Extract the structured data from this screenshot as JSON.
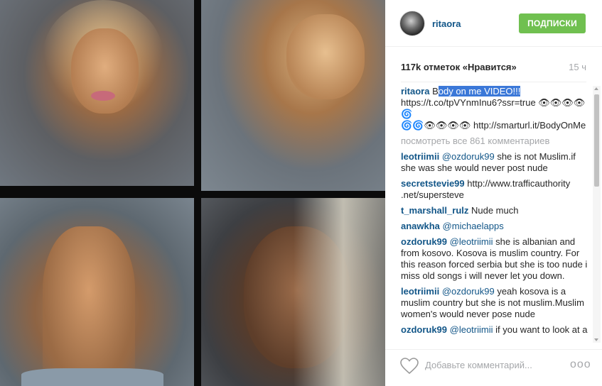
{
  "header": {
    "username": "ritaora",
    "follow_label": "ПОДПИСКИ"
  },
  "stats": {
    "likes": "117k отметок «Нравится»",
    "time": "15 ч"
  },
  "caption": {
    "user": "ritaora",
    "prefix": "B",
    "highlighted": "ody on me VIDEO!!!",
    "line2": "https://t.co/tpVYnmInu6?ssr=true 👁👁👁👁🌀",
    "line3": "🌀🌀👁👁👁👁 http://smarturl.it/BodyOnMe"
  },
  "view_all": "посмотреть все 861 комментариев",
  "comments": [
    {
      "user": "leotriimii",
      "mention": "@ozdoruk99",
      "text": " she is not Muslim.if she was she would never post nude"
    },
    {
      "user": "secretstevie99",
      "mention": "",
      "text": " http://www.trafficauthority .net/supersteve"
    },
    {
      "user": "t_marshall_rulz",
      "mention": "",
      "text": " Nude much"
    },
    {
      "user": "anawkha",
      "mention": "@michaelapps",
      "text": ""
    },
    {
      "user": "ozdoruk99",
      "mention": "@leotriimii",
      "text": " she is albanian and from kosovo. Kosova is muslim country. For this reason forced serbia but she is too nude i miss old songs i will never let you down."
    },
    {
      "user": "leotriimii",
      "mention": "@ozdoruk99",
      "text": " yeah kosova is a muslim country but she is not muslim.Muslim women's would never pose nude"
    },
    {
      "user": "ozdoruk99",
      "mention": "@leotriimii",
      "text": " if you want to look at a"
    }
  ],
  "footer": {
    "comment_placeholder": "Добавьте комментарий...",
    "more_dots": "ooo"
  },
  "icons": {
    "heart": "heart-icon",
    "more": "more-options-icon"
  },
  "colors": {
    "username": "#125688",
    "follow_button": "#70c050",
    "muted": "#a5a7aa",
    "selection": "#3b78d8"
  }
}
